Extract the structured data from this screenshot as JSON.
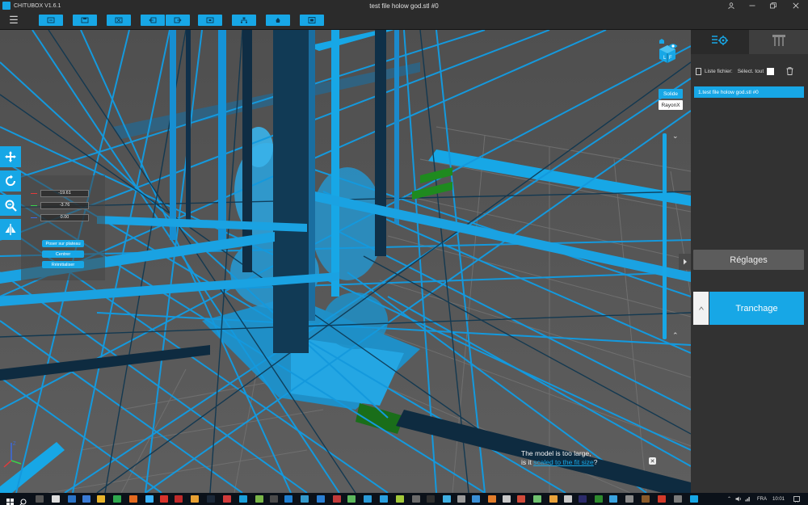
{
  "app": {
    "name": "CHITUBOX V1.6.1",
    "document_title": "test file holow god.stl #0"
  },
  "window_controls": [
    "account-icon",
    "minimize-icon",
    "restore-icon",
    "close-icon"
  ],
  "toolbar": {
    "menu_icon": "hamburger-menu-icon",
    "buttons": [
      "open-file-icon",
      "save-file-icon",
      "import-icon",
      "undo-icon",
      "redo-icon",
      "screenshot-icon",
      "tree-support-icon",
      "hollow-icon",
      "layout-icon"
    ]
  },
  "left_tools": [
    "move-icon",
    "rotate-icon",
    "scale-icon",
    "mirror-icon"
  ],
  "move_panel": {
    "x_value": "-19.61",
    "y_value": "-3.76",
    "z_value": "0.00",
    "x_color": "#e23b3b",
    "y_color": "#3bd14a",
    "z_color": "#3b6be2",
    "drop_to_plate_label": "Poser sur plateau",
    "center_label": "Centrer",
    "reset_label": "Réinitialiser"
  },
  "view_widget": {
    "cube_icon": "view-cube-icon",
    "eye_icon": "eye-icon",
    "cube_faces": [
      "L",
      "F"
    ]
  },
  "render_modes": {
    "solid_label": "Solide",
    "xray_label": "RayonX",
    "active": "Solide"
  },
  "slice_slider": {
    "up_icon": "chevron-up-icon",
    "down_icon": "chevron-down-icon"
  },
  "notice": {
    "line1": "The model is too large,",
    "line2_prefix": "is it ",
    "link": "scaled to the fit size",
    "line2_suffix": "?"
  },
  "right_panel": {
    "tab_model_icon": "model-settings-icon",
    "tab_support_icon": "support-icon",
    "file_list_label": "Liste fichier:",
    "select_all_label": "Sélect. tout",
    "delete_icon": "trash-icon",
    "files": [
      "1.test file holow god.stl #0"
    ],
    "settings_label": "Réglages",
    "slice_label": "Tranchage"
  },
  "taskbar": {
    "language": "FRA",
    "time": "10:01"
  },
  "colors": {
    "accent": "#17a7e6",
    "panel": "#323232",
    "titlebar": "#2b2b2b",
    "viewport": "#585858",
    "plate_grid": "#6e6e6e"
  }
}
